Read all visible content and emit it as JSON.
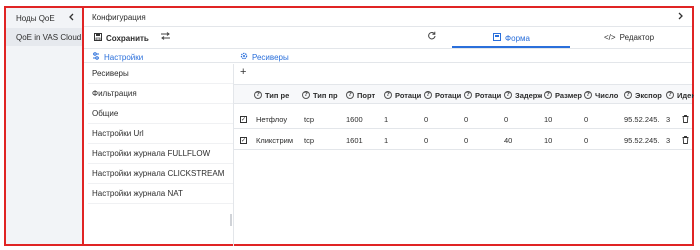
{
  "sidebar": {
    "title": "Ноды QoE",
    "collapse_icon": "chevron-left",
    "items": [
      {
        "label": "QoE in VAS Cloud"
      }
    ]
  },
  "header": {
    "title": "Конфигурация",
    "expand_icon": "chevron-right"
  },
  "toolbar": {
    "save_label": "Сохранить",
    "tabs": [
      {
        "label": "Форма",
        "active": true
      },
      {
        "label": "Редактор",
        "active": false
      }
    ]
  },
  "settings": {
    "title": "Настройки",
    "items": [
      {
        "label": "Ресиверы"
      },
      {
        "label": "Фильтрация"
      },
      {
        "label": "Общие"
      },
      {
        "label": "Настройки Url"
      },
      {
        "label": "Настройки журнала FULLFLOW"
      },
      {
        "label": "Настройки журнала CLICKSTREAM"
      },
      {
        "label": "Настройки журнала NAT"
      }
    ]
  },
  "receivers": {
    "title": "Ресиверы",
    "add_label": "+",
    "columns": [
      "Тип ре",
      "Тип пр",
      "Порт",
      "Ротаци",
      "Ротаци",
      "Ротаци",
      "Задерж",
      "Размер",
      "Число",
      "Экспор",
      "Идент"
    ],
    "rows": [
      {
        "cells": [
          "Нетфлоу",
          "tcp",
          "1600",
          "1",
          "0",
          "0",
          "0",
          "10",
          "0",
          "95.52.245.",
          "3"
        ]
      },
      {
        "cells": [
          "Кликстрим",
          "tcp",
          "1601",
          "1",
          "0",
          "0",
          "40",
          "10",
          "0",
          "95.52.245.",
          "3"
        ]
      }
    ]
  },
  "colors": {
    "frame": "#e02424",
    "accent": "#2a6fdb"
  }
}
